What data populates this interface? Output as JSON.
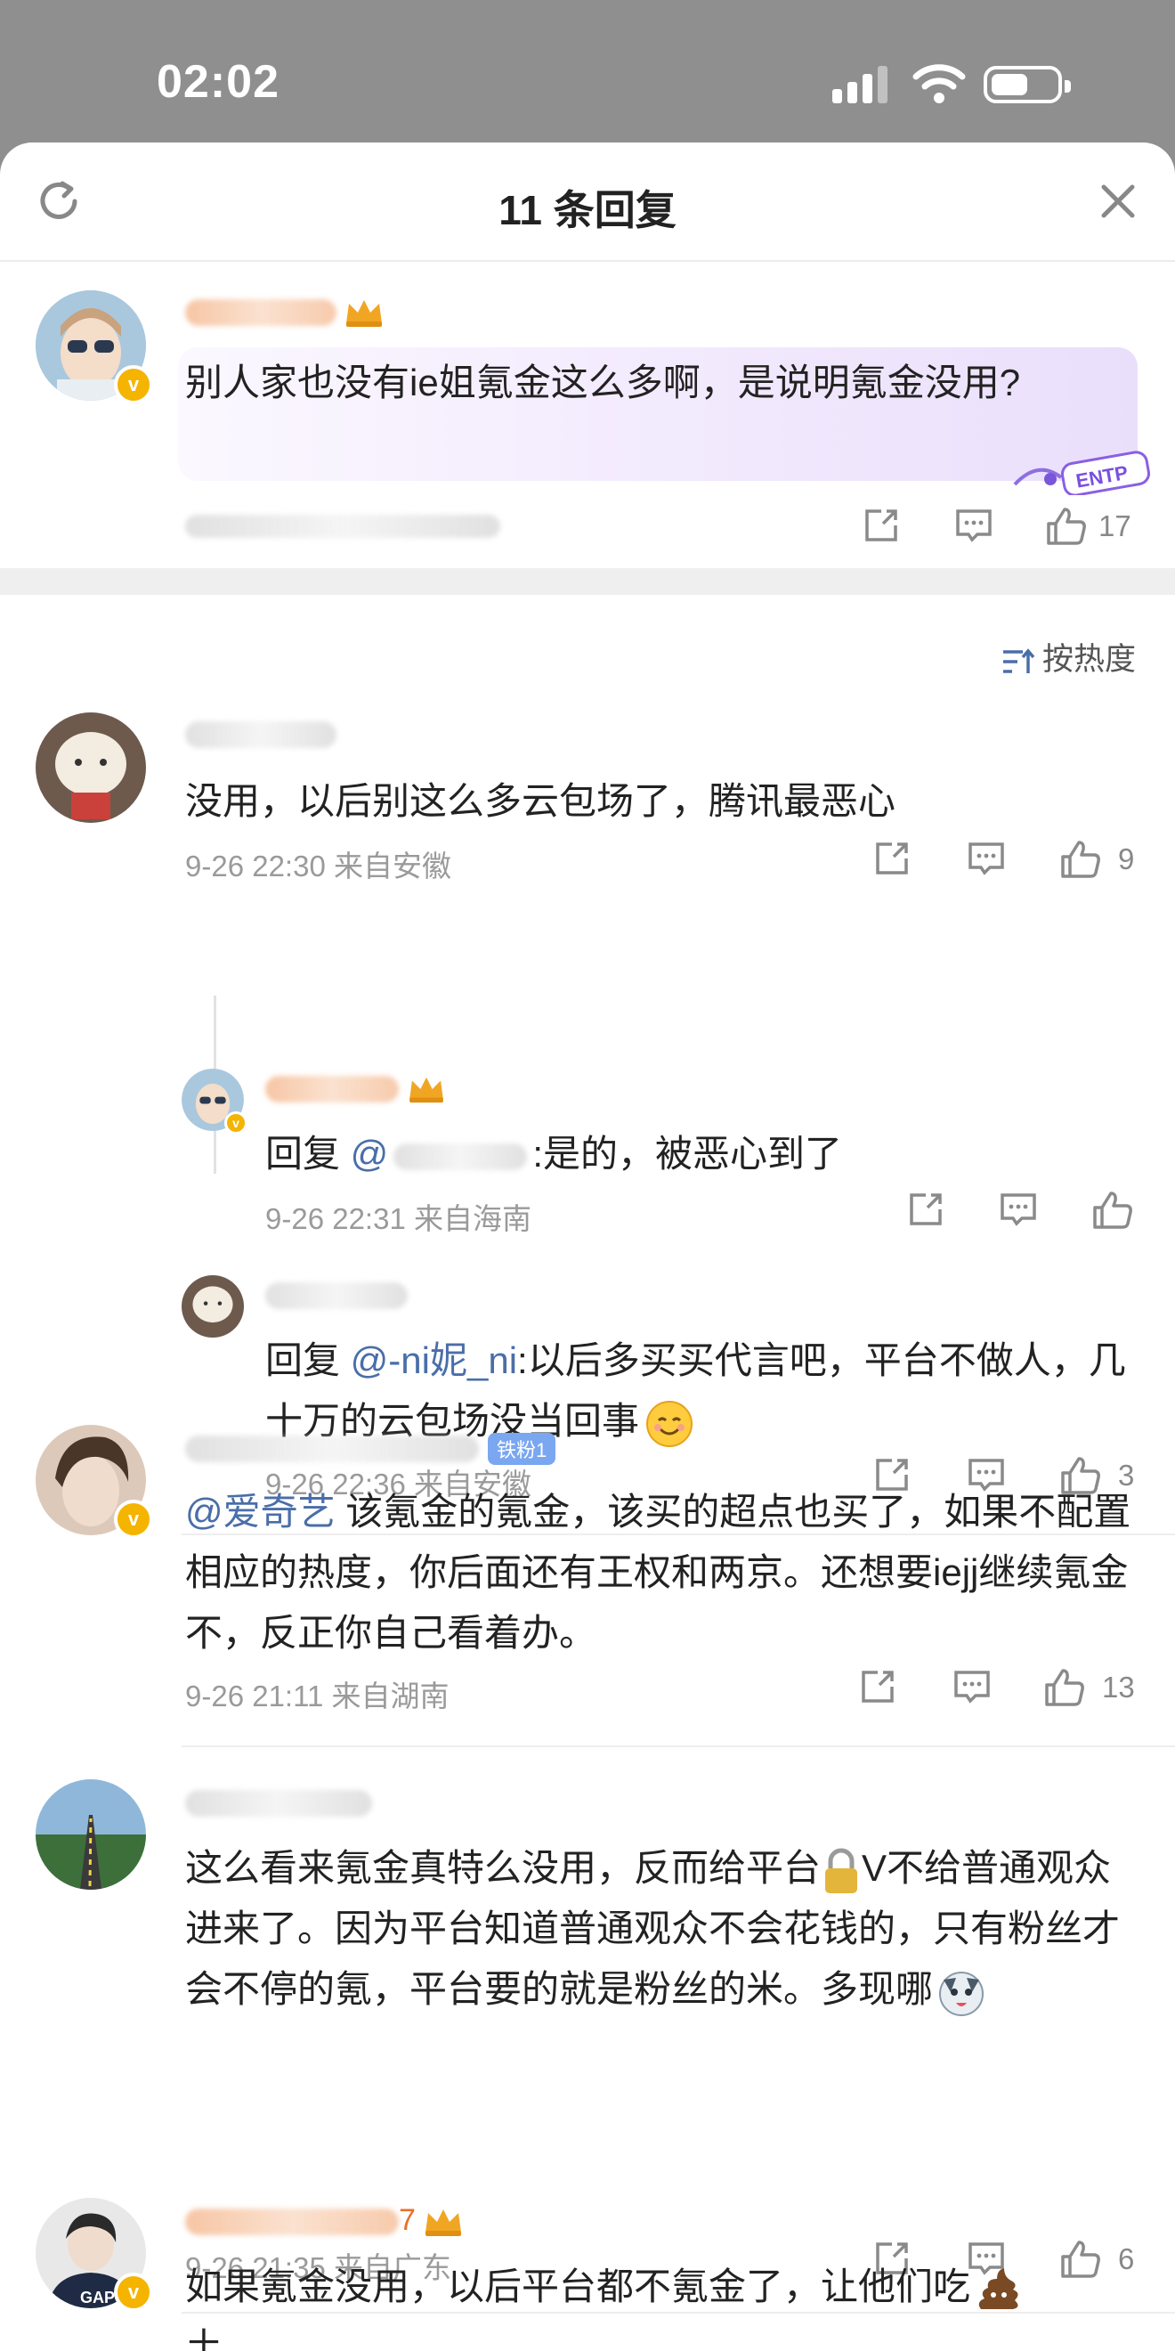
{
  "status_bar": {
    "time": "02:02"
  },
  "header": {
    "title": "11 条回复"
  },
  "sort": {
    "label": "按热度"
  },
  "pinned": {
    "text": "别人家也没有ie姐氪金这么多啊，是说明氪金没用?",
    "likes": "17",
    "sticker": "ENTP"
  },
  "comments": [
    {
      "text": "没用，以后别这么多云包场了，腾讯最恶心",
      "meta": "9-26 22:30 来自安徽",
      "likes": "9",
      "replies": [
        {
          "prefix": "回复 ",
          "mention": "@",
          "text": ":是的，被恶心到了",
          "meta": "9-26 22:31 来自海南",
          "likes": ""
        },
        {
          "prefix": "回复 ",
          "mention": "@-ni妮_ni",
          "text": ":以后多买买代言吧，平台不做人，几十万的云包场没当回事",
          "meta": "9-26 22:36 来自安徽",
          "likes": "3"
        }
      ]
    },
    {
      "fan_badge": "铁粉1",
      "mention": "@爱奇艺",
      "text": " 该氪金的氪金，该买的超点也买了，如果不配置相应的热度，你后面还有王权和两京。还想要iejj继续氪金不，反正你自己看着办。",
      "meta": "9-26 21:11 来自湖南",
      "likes": "13"
    },
    {
      "text_a": "这么看来氪金真特么没用，反而给平台",
      "text_b": "V不给普通观众进来了。因为平台知道普通观众不会花钱的，只有粉丝才会不停的氪，平台要的就是粉丝的米。多现哪",
      "meta": "9-26 21:35 来自广东",
      "likes": "6"
    },
    {
      "name_suffix": "7",
      "text": "如果氪金没用，以后平台都不氪金了，让他们吃",
      "text_tail": "土"
    }
  ],
  "icon_names": [
    "refresh-icon",
    "close-icon",
    "share-icon",
    "comment-icon",
    "like-icon",
    "sort-icon",
    "lock-emoji",
    "poop-emoji",
    "smile-emoji",
    "husky-emoji"
  ],
  "colors": {
    "accent_link": "#4a6ea9",
    "username": "#e8702b",
    "meta": "#9a9a9a",
    "vip": "#f4b400"
  }
}
